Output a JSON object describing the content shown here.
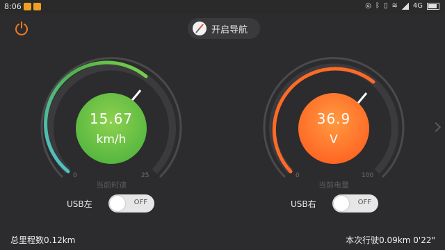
{
  "statusbar": {
    "time": "8:06",
    "network": "4G"
  },
  "nav": {
    "label": "开启导航"
  },
  "speed_gauge": {
    "value": "15.67",
    "unit": "km/h",
    "min": "0",
    "max": "25",
    "caption": "当前时速"
  },
  "battery_gauge": {
    "value": "36.9",
    "unit": "V",
    "min": "0",
    "max": "100",
    "caption": "当前电量"
  },
  "usb_left": {
    "label": "USB左",
    "state": "OFF"
  },
  "usb_right": {
    "label": "USB右",
    "state": "OFF"
  },
  "footer": {
    "total": "总里程数0.12km",
    "trip": "本次行驶0.09km 0'22\""
  },
  "colors": {
    "speed_arc": "#5ab941",
    "battery_arc": "#ff6a26",
    "background": "#2c2c2e"
  }
}
